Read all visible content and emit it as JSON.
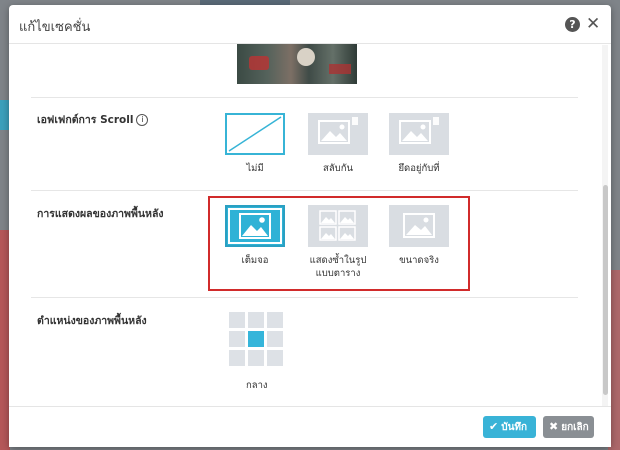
{
  "modal": {
    "title": "แก้ไขเซคชั่น",
    "help_icon": "?",
    "close_icon": "✕"
  },
  "scroll_effect": {
    "label": "เอฟเฟกต์การ Scroll",
    "info_icon": "i",
    "options": [
      {
        "label": "ไม่มี",
        "selected": true,
        "icon": "no-effect-icon"
      },
      {
        "label": "สลับกัน",
        "selected": false,
        "icon": "image-icon"
      },
      {
        "label": "ยึดอยู่กับที่",
        "selected": false,
        "icon": "image-icon"
      }
    ]
  },
  "background_display": {
    "label": "การแสดงผลของภาพพื้นหลัง",
    "options": [
      {
        "label": "เต็มจอ",
        "selected": true,
        "icon": "image-icon"
      },
      {
        "label_line1": "แสดงซ้ำในรูป",
        "label_line2": "แบบตาราง",
        "selected": false,
        "icon": "image-grid-icon"
      },
      {
        "label": "ขนาดจริง",
        "selected": false,
        "icon": "image-icon"
      }
    ],
    "highlight_color": "#d12b2b"
  },
  "background_position": {
    "label": "ตำแหน่งของภาพพื้นหลัง",
    "selected_index": 4,
    "selected_label": "กลาง"
  },
  "footer": {
    "save_label": "บันทึก",
    "cancel_label": "ยกเลิก"
  },
  "colors": {
    "accent": "#2fb2d6",
    "tile": "#d9dde2",
    "cancel": "#8a8f94"
  }
}
